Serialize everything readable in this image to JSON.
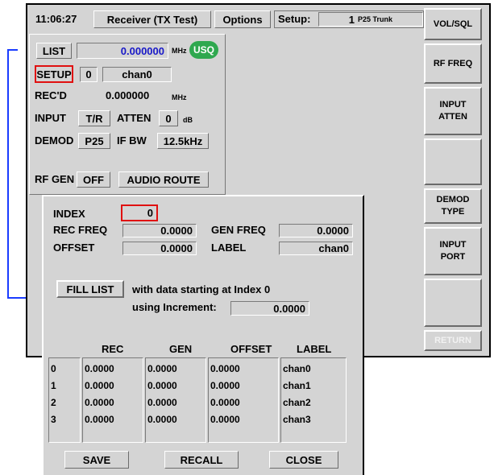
{
  "topbar": {
    "time": "11:06:27",
    "mode": "Receiver (TX Test)",
    "options": "Options",
    "setup_label": "Setup:",
    "setup_num": "1",
    "setup_name": "P25 Trunk"
  },
  "panel": {
    "list_btn": "LIST",
    "list_value": "0.000000",
    "mhz": "MHz",
    "usq": "USQ",
    "setup_btn": "SETUP",
    "setup_index": "0",
    "setup_name": "chan0",
    "recd_label": "REC'D",
    "recd_value": "0.000000",
    "recd_unit": "MHz",
    "input_label": "INPUT",
    "input_value": "T/R",
    "atten_label": "ATTEN",
    "atten_value": "0",
    "atten_unit": "dB",
    "demod_label": "DEMOD",
    "demod_value": "P25",
    "ifbw_label": "IF BW",
    "ifbw_value": "12.5kHz",
    "rfgen_label": "RF GEN",
    "rfgen_value": "OFF",
    "audio_route": "AUDIO ROUTE"
  },
  "softkeys": {
    "k1": "VOL/SQL",
    "k2": "RF FREQ",
    "k3a": "INPUT",
    "k3b": "ATTEN",
    "k5a": "DEMOD",
    "k5b": "TYPE",
    "k6a": "INPUT",
    "k6b": "PORT",
    "k8": "RETURN"
  },
  "dialog": {
    "index_label": "INDEX",
    "index_value": "0",
    "rec_freq_label": "REC FREQ",
    "rec_freq_value": "0.0000",
    "gen_freq_label": "GEN FREQ",
    "gen_freq_value": "0.0000",
    "offset_label": "OFFSET",
    "offset_value": "0.0000",
    "label_label": "LABEL",
    "label_value": "chan0",
    "fill_list_btn": "FILL LIST",
    "fill_text": "with data starting at Index  0",
    "increment_text": "using Increment:",
    "increment_value": "0.0000",
    "headers": {
      "rec": "REC",
      "gen": "GEN",
      "offset": "OFFSET",
      "label": "LABEL"
    },
    "rows": [
      {
        "idx": "0",
        "rec": "0.0000",
        "gen": "0.0000",
        "offset": "0.0000",
        "label": "chan0"
      },
      {
        "idx": "1",
        "rec": "0.0000",
        "gen": "0.0000",
        "offset": "0.0000",
        "label": "chan1"
      },
      {
        "idx": "2",
        "rec": "0.0000",
        "gen": "0.0000",
        "offset": "0.0000",
        "label": "chan2"
      },
      {
        "idx": "3",
        "rec": "0.0000",
        "gen": "0.0000",
        "offset": "0.0000",
        "label": "chan3"
      }
    ],
    "save_btn": "SAVE",
    "recall_btn": "RECALL",
    "close_btn": "CLOSE"
  },
  "colors": {
    "accent_red": "#e01010",
    "pointer_blue": "#1a3cff",
    "usq_green": "#2fa84f",
    "value_blue": "#1818c8"
  }
}
